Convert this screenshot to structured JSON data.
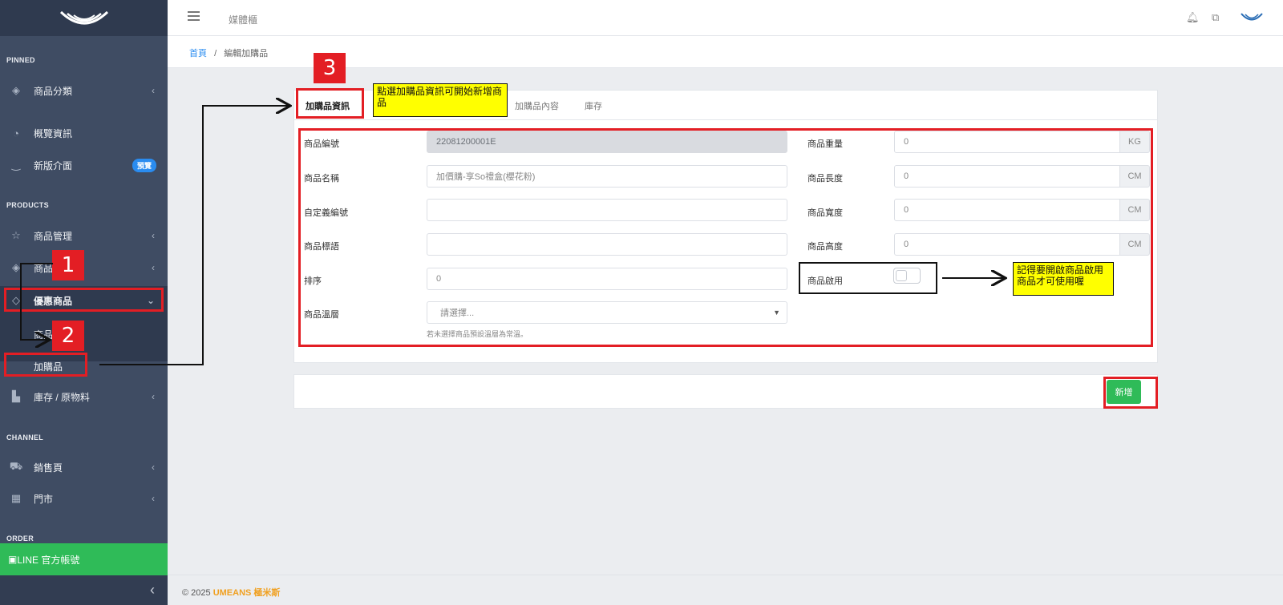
{
  "sidebar": {
    "sections": {
      "pinned": "PINNED",
      "products": "PRODUCTS",
      "channel": "CHANNEL",
      "order": "ORDER"
    },
    "items": {
      "category": "商品分類",
      "overview": "概覽資訊",
      "new_ui": "新版介面",
      "new_ui_badge": "預覽",
      "product_mgmt": "商品管理",
      "product": "商品",
      "discount": "優惠商品",
      "sub_product": "商品",
      "addon": "加購品",
      "inventory": "庫存 / 原物料",
      "sales_page": "銷售頁",
      "store": "門市",
      "line": "LINE 官方帳號"
    }
  },
  "topbar": {
    "title": "媒體櫃"
  },
  "breadcrumb": {
    "home": "首頁",
    "separator": "/",
    "current": "編輯加購品"
  },
  "tabs": {
    "info": "加購品資訊",
    "content": "加購品內容",
    "stock": "庫存"
  },
  "form": {
    "code_label": "商品編號",
    "code_value": "22081200001E",
    "name_label": "商品名稱",
    "name_placeholder": "加價購-享So禮盒(櫻花粉)",
    "custom_code_label": "自定義編號",
    "slogan_label": "商品標語",
    "sort_label": "排序",
    "sort_value": "0",
    "temp_label": "商品溫層",
    "temp_placeholder": "請選擇...",
    "temp_help": "若未選擇商品預設溫層為常溫。",
    "weight_label": "商品重量",
    "weight_value": "0",
    "weight_unit": "KG",
    "length_label": "商品長度",
    "length_value": "0",
    "length_unit": "CM",
    "width_label": "商品寬度",
    "width_value": "0",
    "width_unit": "CM",
    "height_label": "商品高度",
    "height_value": "0",
    "height_unit": "CM",
    "enable_label": "商品啟用"
  },
  "actions": {
    "add": "新增"
  },
  "footer": {
    "copyright": "© 2025",
    "brand": "UMEANS",
    "brand_cn": "極米斯"
  },
  "annotations": {
    "step1": "1",
    "step2": "2",
    "step3": "3",
    "note_tab": "點選加購品資訊可開始新增商品",
    "note_enable": "記得要開啟商品啟用商品才可使用喔"
  },
  "colors": {
    "sidebar": "#3f4c63",
    "accent_blue": "#2a8cf0",
    "green": "#2fbb58",
    "annotation_red": "#e31e24",
    "note_yellow": "#ffff00"
  }
}
